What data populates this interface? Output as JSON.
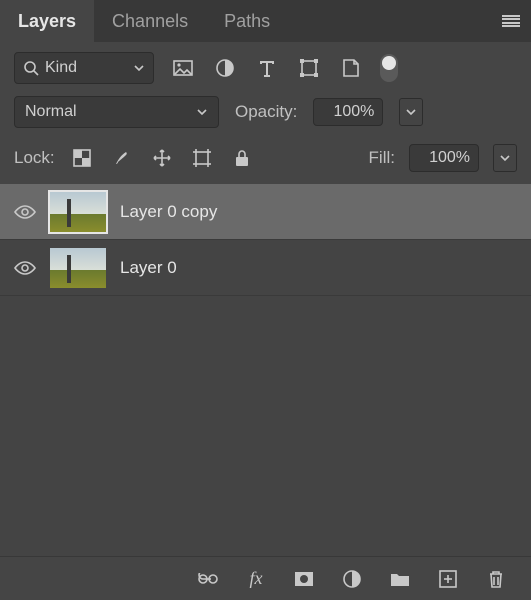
{
  "tabs": {
    "layers": "Layers",
    "channels": "Channels",
    "paths": "Paths"
  },
  "filter": {
    "kind_label": "Kind"
  },
  "blend": {
    "mode": "Normal",
    "opacity_label": "Opacity:",
    "opacity_value": "100%"
  },
  "lock": {
    "label": "Lock:",
    "fill_label": "Fill:",
    "fill_value": "100%"
  },
  "layers_list": [
    {
      "name": "Layer 0 copy",
      "visible": true,
      "selected": true
    },
    {
      "name": "Layer 0",
      "visible": true,
      "selected": false
    }
  ]
}
